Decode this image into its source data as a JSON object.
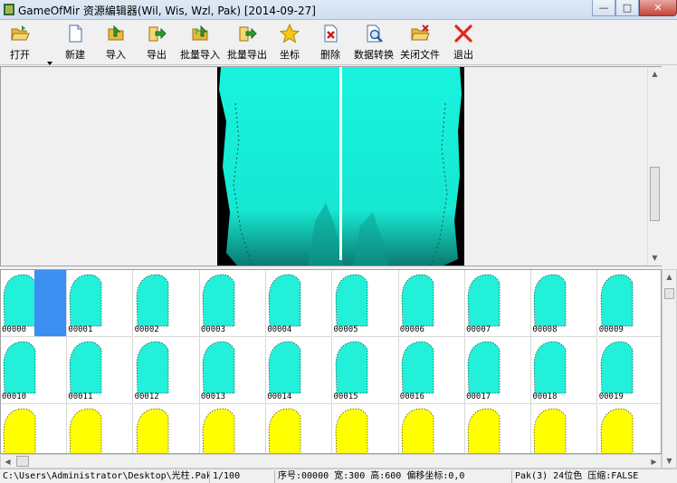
{
  "window": {
    "title": "GameOfMir 资源编辑器(Wil, Wis, Wzl, Pak) [2014-09-27]",
    "min_glyph": "—",
    "max_glyph": "□",
    "close_glyph": "✕"
  },
  "toolbar": {
    "items": [
      {
        "label": "打开",
        "icon": "folder-open-icon"
      },
      {
        "label": "新建",
        "icon": "new-file-icon"
      },
      {
        "label": "导入",
        "icon": "import-icon"
      },
      {
        "label": "导出",
        "icon": "export-icon"
      },
      {
        "label": "批量导入",
        "icon": "batch-import-icon"
      },
      {
        "label": "批量导出",
        "icon": "batch-export-icon"
      },
      {
        "label": "坐标",
        "icon": "star-icon"
      },
      {
        "label": "删除",
        "icon": "delete-icon"
      },
      {
        "label": "数据转换",
        "icon": "convert-icon"
      },
      {
        "label": "关闭文件",
        "icon": "close-file-icon"
      },
      {
        "label": "退出",
        "icon": "exit-icon"
      }
    ]
  },
  "grid": {
    "rows": [
      {
        "color": "#22f0d8",
        "cells": [
          "00000",
          "00001",
          "00002",
          "00003",
          "00004",
          "00005",
          "00006",
          "00007",
          "00008",
          "00009"
        ]
      },
      {
        "color": "#22f0d8",
        "cells": [
          "00010",
          "00011",
          "00012",
          "00013",
          "00014",
          "00015",
          "00016",
          "00017",
          "00018",
          "00019"
        ]
      },
      {
        "color": "#ffff00",
        "cells": [
          "",
          "",
          "",
          "",
          "",
          "",
          "",
          "",
          "",
          ""
        ]
      }
    ],
    "selected_color": "#3b8ff0"
  },
  "status": {
    "path": "C:\\Users\\Administrator\\Desktop\\光柱.Pak",
    "count": "1/100",
    "info": "序号:00000 宽:300 高:600 偏移坐标:0,0",
    "format": "Pak(3) 24位色 压缩:FALSE"
  },
  "colors": {
    "cyan": "#22f0d8",
    "yellow": "#ffff00",
    "selection": "#3b8ff0"
  }
}
